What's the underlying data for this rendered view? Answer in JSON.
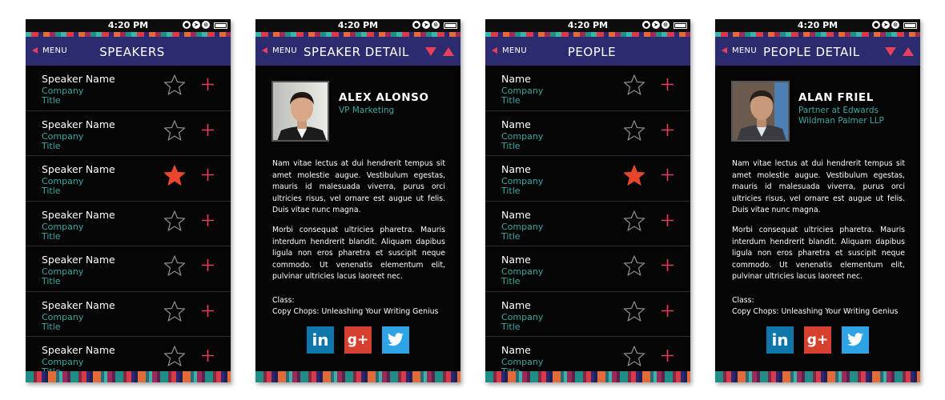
{
  "status_time": "4:20 PM",
  "colors": {
    "navbar": "#2d2b6f",
    "accent": "#e8405a",
    "teal": "#3aa7a2",
    "star_filled": "#e8452e"
  },
  "menu_label": "MENU",
  "speakers": {
    "title": "SPEAKERS",
    "rows": [
      {
        "name": "Speaker Name",
        "company": "Company",
        "title": "Title",
        "favorite": false
      },
      {
        "name": "Speaker Name",
        "company": "Company",
        "title": "Title",
        "favorite": false
      },
      {
        "name": "Speaker Name",
        "company": "Company",
        "title": "Title",
        "favorite": true
      },
      {
        "name": "Speaker Name",
        "company": "Company",
        "title": "Title",
        "favorite": false
      },
      {
        "name": "Speaker Name",
        "company": "Company",
        "title": "Title",
        "favorite": false
      },
      {
        "name": "Speaker Name",
        "company": "Company",
        "title": "Title",
        "favorite": false
      },
      {
        "name": "Speaker Name",
        "company": "Company",
        "title": "Title",
        "favorite": false
      }
    ]
  },
  "speaker_detail": {
    "title": "SPEAKER DETAIL",
    "name": "ALEX ALONSO",
    "role": "VP Marketing",
    "bio_p1": "Nam vitae lectus at dui hendrerit tempus sit amet molestie augue. Vestibulum egestas, mauris id malesuada viverra, purus orci ultricies risus, vel ornare est augue ut felis. Duis vitae nunc magna.",
    "bio_p2": "Morbi consequat ultricies pharetra. Mauris interdum hendrerit blandit. Aliquam dapibus ligula non eros pharetra et suscipit neque commodo. Ut venenatis elementum elit, pulvinar ultricies lacus laoreet nec.",
    "class_label": "Class:",
    "class_value": "Copy Chops: Unleashing Your Writing Genius"
  },
  "people": {
    "title": "PEOPLE",
    "rows": [
      {
        "name": "Name",
        "company": "Company",
        "title": "Title",
        "favorite": false
      },
      {
        "name": "Name",
        "company": "Company",
        "title": "Title",
        "favorite": false
      },
      {
        "name": "Name",
        "company": "Company",
        "title": "Title",
        "favorite": true
      },
      {
        "name": "Name",
        "company": "Company",
        "title": "Title",
        "favorite": false
      },
      {
        "name": "Name",
        "company": "Company",
        "title": "Title",
        "favorite": false
      },
      {
        "name": "Name",
        "company": "Company",
        "title": "Title",
        "favorite": false
      },
      {
        "name": "Name",
        "company": "Company",
        "title": "Title",
        "favorite": false
      }
    ]
  },
  "people_detail": {
    "title": "PEOPLE DETAIL",
    "name": "ALAN FRIEL",
    "role": "Partner at Edwards Wildman Palmer LLP",
    "bio_p1": "Nam vitae lectus at dui hendrerit tempus sit amet molestie augue. Vestibulum egestas, mauris id malesuada viverra, purus orci ultricies risus, vel ornare est augue ut felis. Duis vitae nunc magna.",
    "bio_p2": "Morbi consequat ultricies pharetra. Mauris interdum hendrerit blandit. Aliquam dapibus ligula non eros pharetra et suscipit neque commodo. Ut venenatis elementum elit, pulvinar ultricies lacus laoreet nec.",
    "class_label": "Class:",
    "class_value": "Copy Chops: Unleashing Your Writing Genius"
  },
  "social": {
    "linkedin_glyph": "in",
    "gplus_glyph": "g+"
  }
}
